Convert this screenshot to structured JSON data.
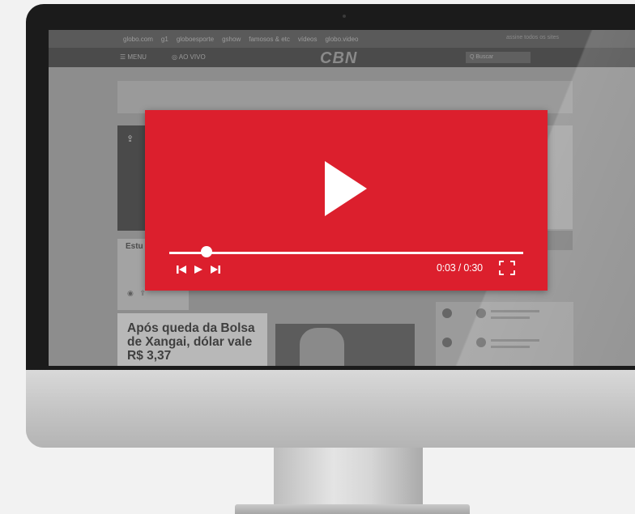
{
  "website": {
    "topbar_items": [
      "globo.com",
      "g1",
      "globoesporte",
      "gshow",
      "famosos & etc",
      "vídeos",
      "globo.video"
    ],
    "topbar_right": "assine  todos os sites",
    "nav_menu": "☰ MENU",
    "nav_live": "◎ AO VIVO",
    "logo": "CBN",
    "search_placeholder": "Q  Buscar",
    "snippet_title": "Estu prof",
    "headline": "Após queda da Bolsa de Xangai, dólar vale R$ 3,37"
  },
  "player": {
    "background_color": "#dc1f2d",
    "progress_fraction": 0.105,
    "time_display": "0:03 / 0:30",
    "controls": [
      "skip-back-icon",
      "play-icon",
      "skip-forward-icon"
    ]
  }
}
